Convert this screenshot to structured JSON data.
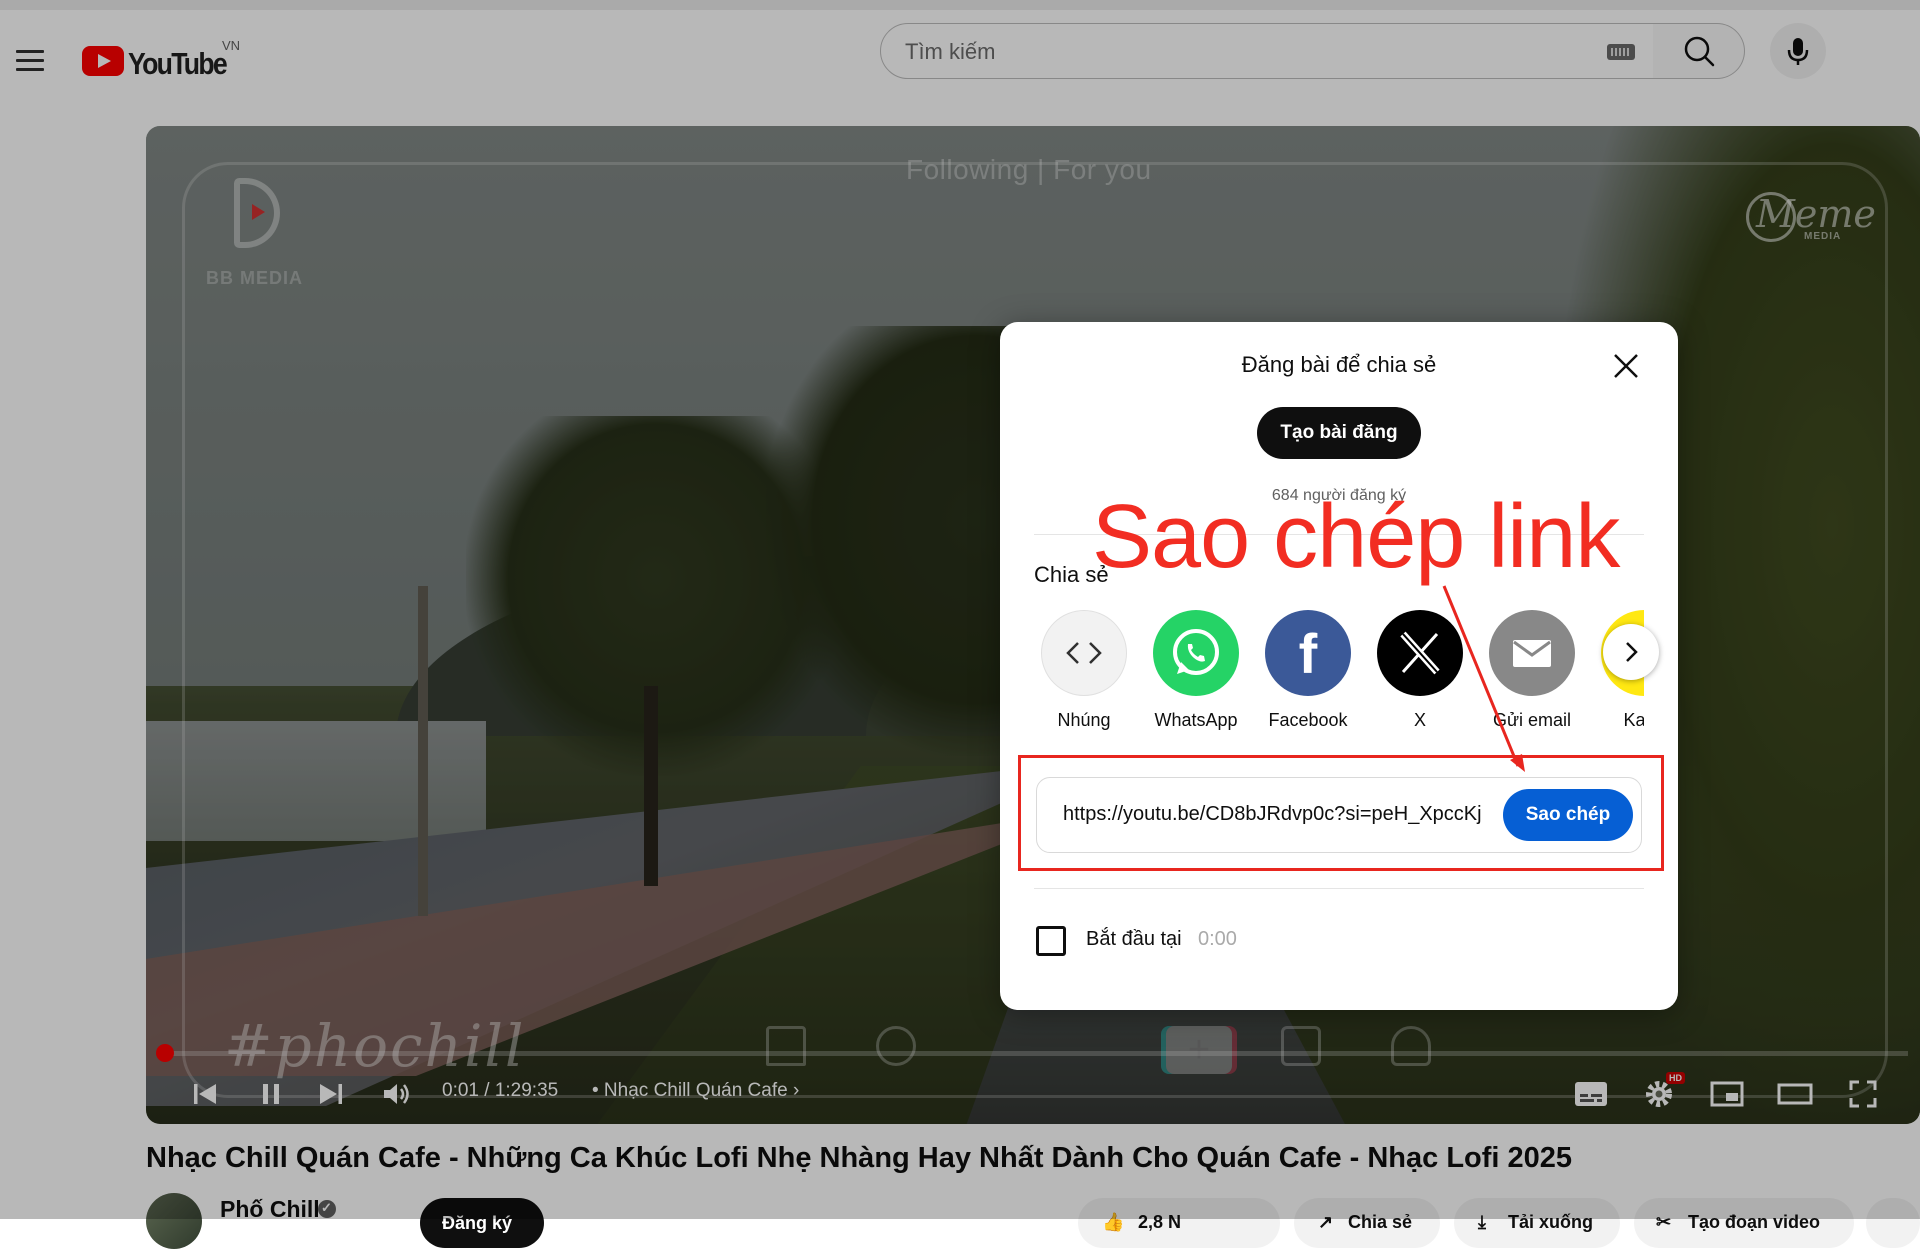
{
  "header": {
    "logo_text": "YouTube",
    "logo_region": "VN",
    "search_placeholder": "Tìm kiếm"
  },
  "player": {
    "watermark_tabs": "Following  |  For you",
    "bb_logo_text": "BB MEDIA",
    "meme_logo_text": "Meme",
    "meme_logo_sub": "MEDIA",
    "hashtag_watermark": "#phochill",
    "time": "0:01 / 1:29:35",
    "chapter": "• Nhạc Chill Quán Cafe",
    "hd_badge": "HD",
    "progress_fraction": 0.003
  },
  "share_dialog": {
    "title": "Đăng bài để chia sẻ",
    "create_post_label": "Tạo bài đăng",
    "subscribers": "684 người đăng ký",
    "share_label": "Chia sẻ",
    "targets": [
      {
        "name": "Nhúng",
        "icon": "embed-icon",
        "color": "#f2f2f2"
      },
      {
        "name": "WhatsApp",
        "icon": "whatsapp-icon",
        "color": "#25d366"
      },
      {
        "name": "Facebook",
        "icon": "facebook-icon",
        "color": "#3b5998"
      },
      {
        "name": "X",
        "icon": "x-icon",
        "color": "#000000"
      },
      {
        "name": "Gửi email",
        "icon": "email-icon",
        "color": "#888888"
      },
      {
        "name": "Kaka",
        "icon": "kakaotalk-icon",
        "color": "#ffe812"
      }
    ],
    "url": "https://youtu.be/CD8bJRdvp0c?si=peH_XpccKj",
    "copy_label": "Sao chép",
    "start_at_label": "Bắt đầu tại",
    "start_at_time": "0:00"
  },
  "annotation": {
    "text": "Sao chép link",
    "color": "#f22d22"
  },
  "video": {
    "title": "Nhạc Chill Quán Cafe - Những Ca Khúc Lofi Nhẹ Nhàng Hay Nhất Dành Cho Quán Cafe - Nhạc Lofi 2025",
    "channel_name": "Phố Chill",
    "subscribe_label": "Đăng ký",
    "like_count": "2,8 N",
    "share_label": "Chia sẻ",
    "download_label": "Tải xuống",
    "clip_label": "Tạo đoạn video"
  }
}
